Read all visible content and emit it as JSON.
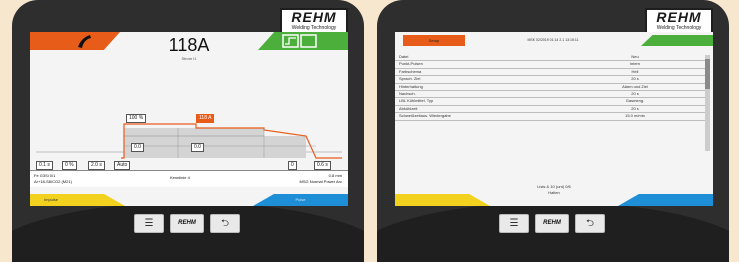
{
  "logo": {
    "main": "REHM",
    "sub": "Welding Technology"
  },
  "left": {
    "main_value": "118A",
    "sub_value": "Strom I1",
    "graph": {
      "percent_box": "100 %",
      "orange_box": "118 A",
      "left_small": "0.0",
      "mid_small": "0.0",
      "right_small": "0.0 s"
    },
    "bottom_boxes": [
      "0.1 s",
      "0 %",
      "2.0 s",
      "Auto",
      "0",
      "0.6 s"
    ],
    "status_left_line1": "Fe G3Si 0/1",
    "status_left_line2": "Ar+18-S8/CO2 (M21)",
    "status_center": "Kennlinie 4",
    "status_right_line1": "0.8 mm",
    "status_right_line2": "MSG Normal Power Arc",
    "footer_left": "Impulse",
    "footer_right": "Pulse",
    "speaker": "◀"
  },
  "right": {
    "tab_setup": "Setup",
    "title": "MSK 02/2019 01:14 2.1 13:15:11",
    "rows": [
      {
        "k": "Datei",
        "v": "Neu"
      },
      {
        "k": "Punkt-Pulsen",
        "v": "Intern"
      },
      {
        "k": "Farbschema",
        "v": "Hell"
      },
      {
        "k": "Sprach. Ziel",
        "v": "20 s"
      },
      {
        "k": "Hinterhaltung",
        "v": "Alarm und Ziel"
      },
      {
        "k": "Nachsch.",
        "v": "20 s"
      },
      {
        "k": "LBL Kühlmittel. Typ",
        "v": "Gasmeng."
      },
      {
        "k": "Abkühlzeit",
        "v": "20 s"
      },
      {
        "k": "Schweißzeitaus. Wiedergabe",
        "v": "15.0 m/min"
      }
    ],
    "msg_line1": "Lists & 10 (unt) 0/6",
    "msg_line2": "Halten",
    "speaker": "◀"
  },
  "buttons": {
    "menu": "☰",
    "rehm": "REHM",
    "back": "⮌"
  }
}
